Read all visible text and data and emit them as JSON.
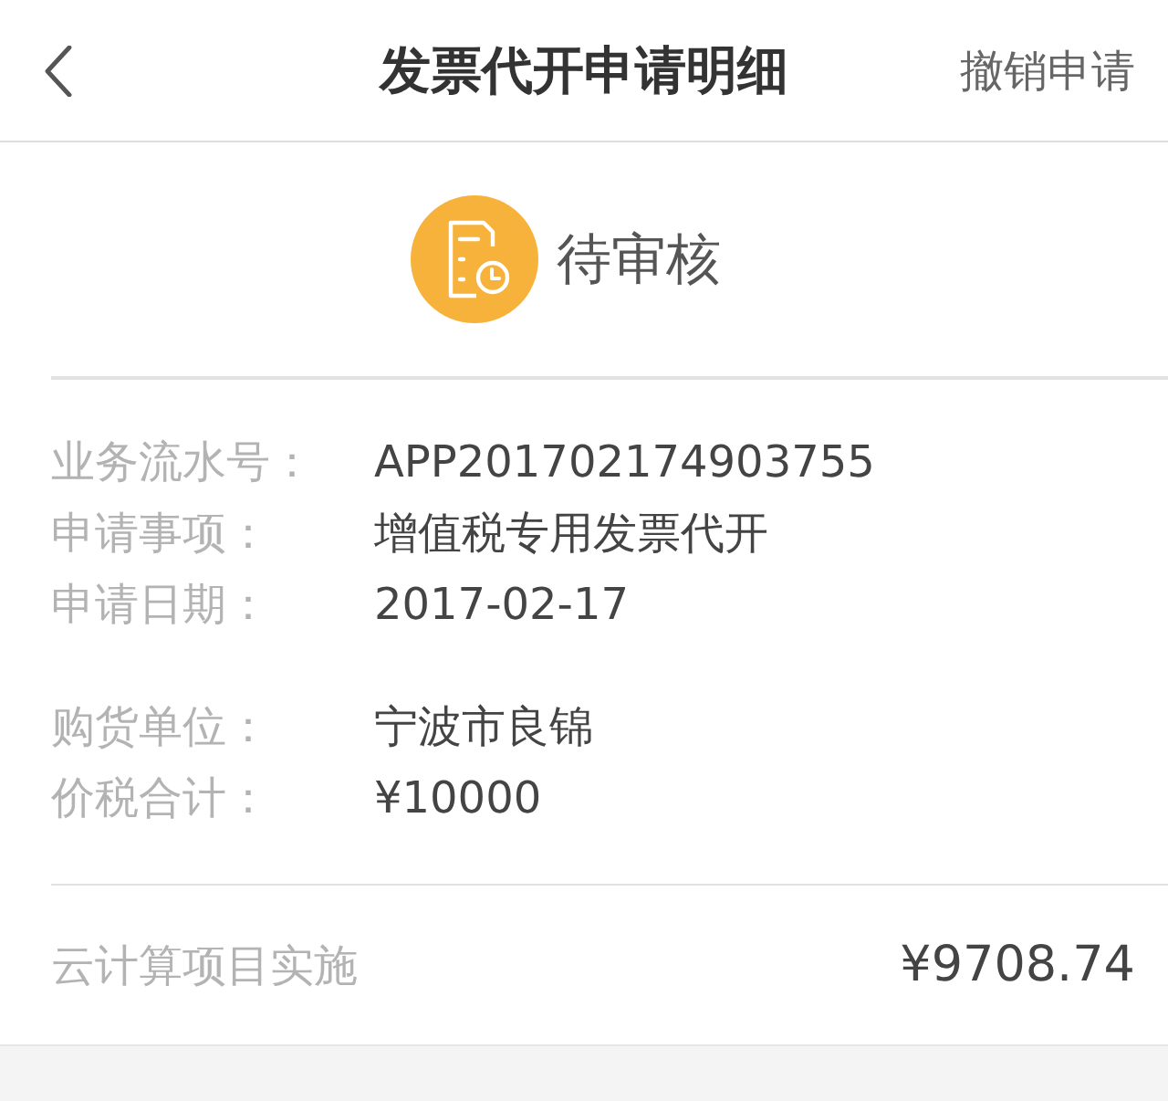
{
  "header": {
    "title": "发票代开申请明细",
    "action": "撤销申请"
  },
  "status": {
    "label": "待审核"
  },
  "info_groups": [
    [
      {
        "label": "业务流水号：",
        "value": "APP201702174903755"
      },
      {
        "label": "申请事项：",
        "value": "增值税专用发票代开"
      },
      {
        "label": "申请日期：",
        "value": "2017-02-17"
      }
    ],
    [
      {
        "label": "购货单位：",
        "value": "宁波市良锦"
      },
      {
        "label": "价税合计：",
        "value": "¥10000"
      }
    ]
  ],
  "items": [
    {
      "name": "云计算项目实施",
      "amount": "¥9708.74"
    }
  ]
}
